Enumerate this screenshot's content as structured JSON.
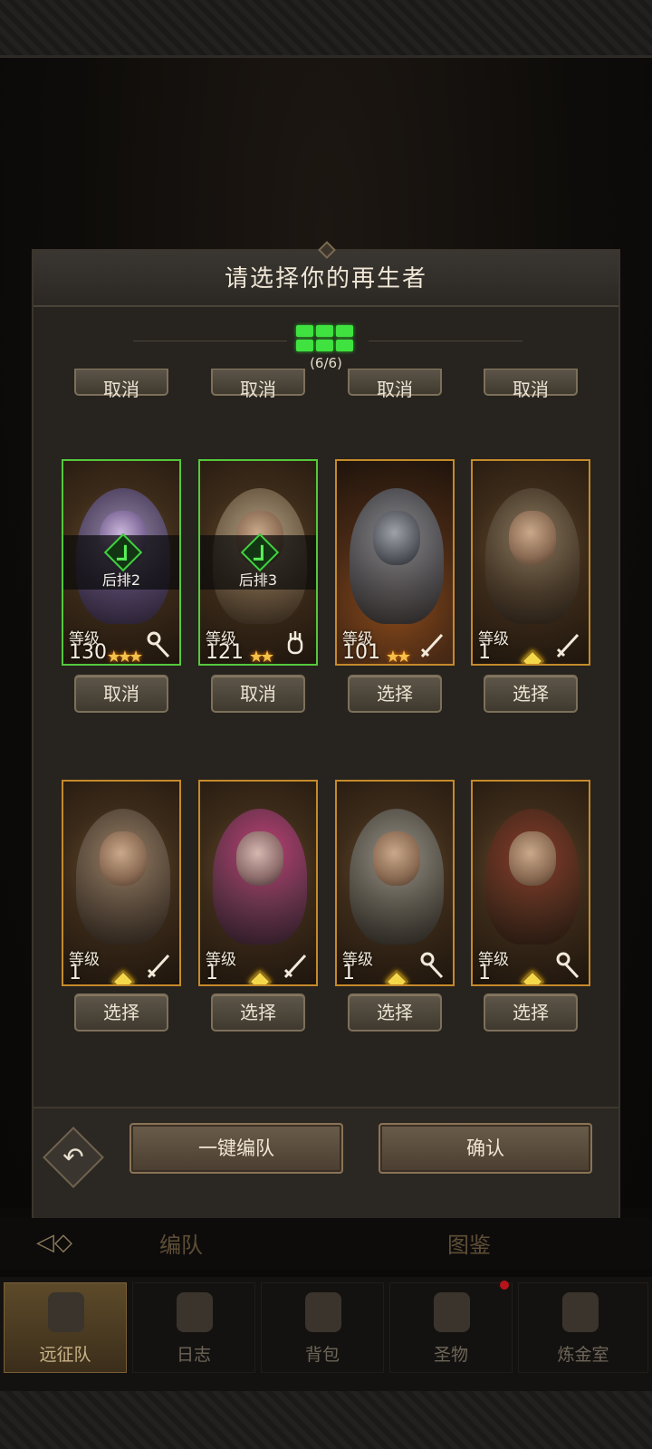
{
  "modal": {
    "title": "请选择你的再生者",
    "slot_count": "(6/6)",
    "top_row_buttons": [
      "取消",
      "取消",
      "取消",
      "取消"
    ]
  },
  "heroes": [
    {
      "level_label": "等级",
      "level": "130",
      "status_label": "后排2",
      "button": "取消",
      "class_icon": "staff-icon",
      "selected": true
    },
    {
      "level_label": "等级",
      "level": "121",
      "status_label": "后排3",
      "button": "取消",
      "class_icon": "hand-icon",
      "selected": true
    },
    {
      "level_label": "等级",
      "level": "101",
      "status_label": "",
      "button": "选择",
      "class_icon": "sword-icon",
      "selected": false
    },
    {
      "level_label": "等级",
      "level": "1",
      "status_label": "",
      "button": "选择",
      "class_icon": "sword-icon",
      "selected": false
    },
    {
      "level_label": "等级",
      "level": "1",
      "status_label": "",
      "button": "选择",
      "class_icon": "sword-icon",
      "selected": false
    },
    {
      "level_label": "等级",
      "level": "1",
      "status_label": "",
      "button": "选择",
      "class_icon": "sword-icon",
      "selected": false
    },
    {
      "level_label": "等级",
      "level": "1",
      "status_label": "",
      "button": "选择",
      "class_icon": "staff-icon",
      "selected": false
    },
    {
      "level_label": "等级",
      "level": "1",
      "status_label": "",
      "button": "选择",
      "class_icon": "staff-icon",
      "selected": false
    }
  ],
  "footer": {
    "auto_team": "一键编队",
    "confirm": "确认",
    "undo_icon": "undo-icon"
  },
  "tabs": [
    "编队",
    "图鉴"
  ],
  "bottom_nav": [
    "远征队",
    "日志",
    "背包",
    "圣物",
    "炼金室"
  ],
  "colors": {
    "selected_border": "#55c83c",
    "slot_green": "#3fe23f",
    "gold_border": "#c58a2a"
  }
}
